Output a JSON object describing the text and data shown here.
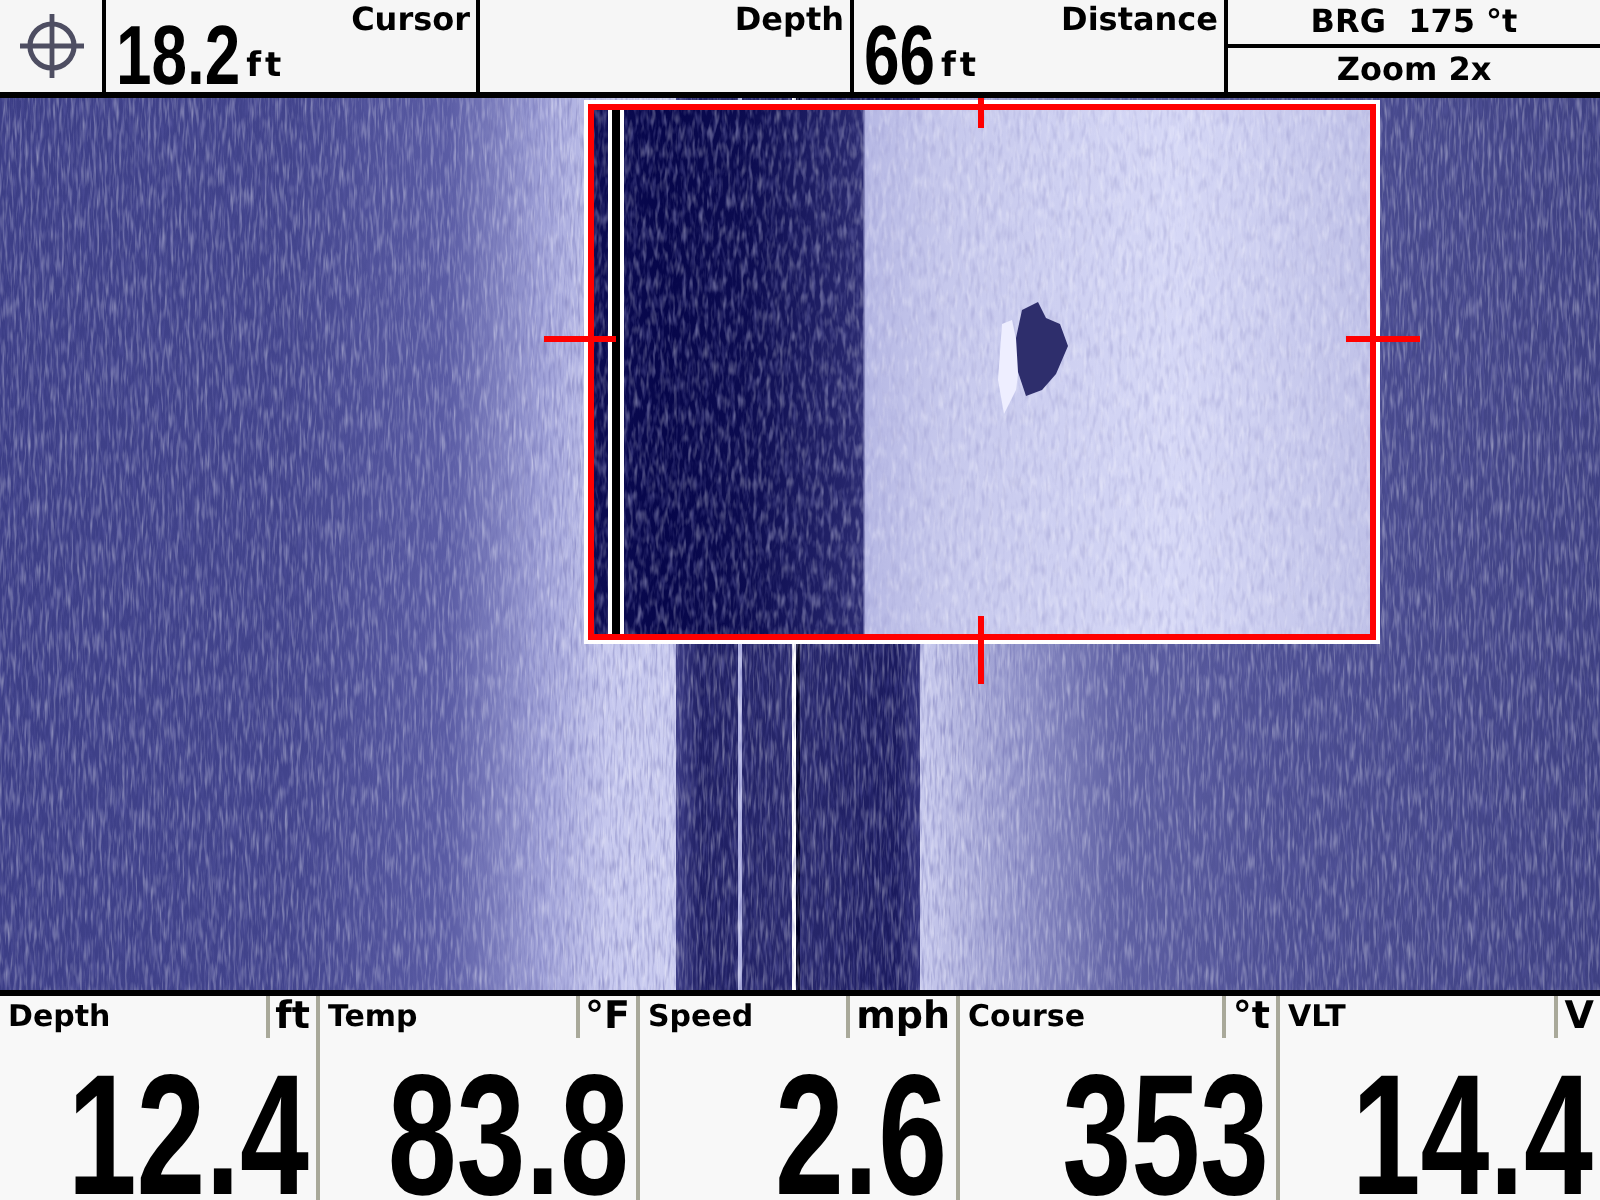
{
  "top_bar": {
    "items": [
      {
        "kind": "reading",
        "value": "18.2",
        "unit": "ft"
      },
      {
        "kind": "label",
        "text": "Cursor"
      },
      {
        "kind": "label",
        "text": "Depth"
      },
      {
        "kind": "reading",
        "value": "66",
        "unit": "ft"
      },
      {
        "kind": "label",
        "text": "Distance"
      }
    ],
    "bearing": "BRG  175 °t",
    "zoom": "Zoom 2x"
  },
  "bottom_bar": {
    "readouts": [
      {
        "label": "Depth",
        "unit": "ft",
        "value": "12.4"
      },
      {
        "label": "Temp",
        "unit": "°F",
        "value": "83.8"
      },
      {
        "label": "Speed",
        "unit": "mph",
        "value": "2.6"
      },
      {
        "label": "Course",
        "unit": "°t",
        "value": "353"
      },
      {
        "label": "VLT",
        "unit": "V",
        "value": "14.4"
      }
    ]
  }
}
